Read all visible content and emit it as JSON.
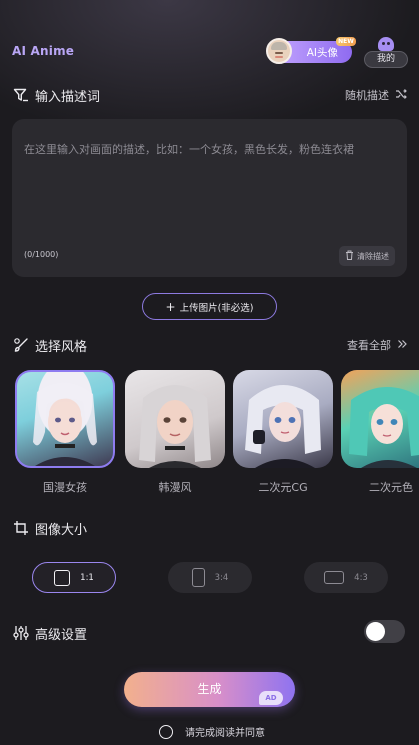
{
  "header": {
    "app_title": "AI Anime",
    "ai_avatar_label": "AI头像",
    "new_badge": "NEW",
    "mine_label": "我的"
  },
  "prompt_section": {
    "title": "输入描述词",
    "random_label": "随机描述",
    "placeholder": "在这里输入对画面的描述，比如：一个女孩，黑色长发，粉色连衣裙",
    "counter": "(0/1000)",
    "clear_label": "清除描述"
  },
  "upload": {
    "label": "上传图片(非必选)"
  },
  "style_section": {
    "title": "选择风格",
    "view_all": "查看全部",
    "styles": [
      {
        "label": "国漫女孩",
        "selected": true
      },
      {
        "label": "韩漫风",
        "selected": false
      },
      {
        "label": "二次元CG",
        "selected": false
      },
      {
        "label": "二次元色",
        "selected": false
      }
    ]
  },
  "size_section": {
    "title": "图像大小",
    "options": [
      {
        "label": "1:1",
        "active": true
      },
      {
        "label": "3:4",
        "active": false
      },
      {
        "label": "4:3",
        "active": false
      }
    ]
  },
  "advanced": {
    "title": "高级设置",
    "enabled": false
  },
  "generate": {
    "label": "生成",
    "ad_badge": "AD"
  },
  "agreement": {
    "text": "请完成阅读并同意"
  },
  "colors": {
    "background": "#1c1b1f",
    "accent": "#8e7cf0",
    "card": "#2b2a2f"
  }
}
